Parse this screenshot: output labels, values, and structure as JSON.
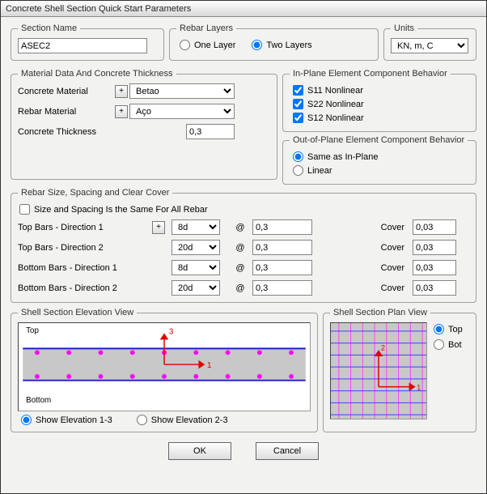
{
  "window_title": "Concrete Shell Section Quick Start Parameters",
  "section_name": {
    "legend": "Section Name",
    "value": "ASEC2"
  },
  "rebar_layers": {
    "legend": "Rebar Layers",
    "one": "One Layer",
    "two": "Two Layers",
    "selected": "two"
  },
  "units": {
    "legend": "Units",
    "value": "KN, m, C"
  },
  "material": {
    "legend": "Material Data And Concrete Thickness",
    "concrete_label": "Concrete Material",
    "concrete_value": "Betao",
    "rebar_label": "Rebar Material",
    "rebar_value": "Aço",
    "thickness_label": "Concrete Thickness",
    "thickness_value": "0,3",
    "plus": "+"
  },
  "inplane": {
    "legend": "In-Plane Element Component Behavior",
    "s11": "S11 Nonlinear",
    "s22": "S22 Nonlinear",
    "s12": "S12 Nonlinear"
  },
  "outplane": {
    "legend": "Out-of-Plane Element Component Behavior",
    "same": "Same as In-Plane",
    "linear": "Linear",
    "selected": "same"
  },
  "rebar_size": {
    "legend": "Rebar Size, Spacing and Clear Cover",
    "same_all": "Size and Spacing Is the Same For All Rebar",
    "rows": [
      {
        "label": "Top Bars  -  Direction 1",
        "size": "8d",
        "at": "@",
        "spacing": "0,3",
        "cover_label": "Cover",
        "cover": "0,03",
        "plus": true
      },
      {
        "label": "Top Bars  -  Direction 2",
        "size": "20d",
        "at": "@",
        "spacing": "0,3",
        "cover_label": "Cover",
        "cover": "0,03",
        "plus": false
      },
      {
        "label": "Bottom Bars  -  Direction 1",
        "size": "8d",
        "at": "@",
        "spacing": "0,3",
        "cover_label": "Cover",
        "cover": "0,03",
        "plus": false
      },
      {
        "label": "Bottom Bars  -  Direction 2",
        "size": "20d",
        "at": "@",
        "spacing": "0,3",
        "cover_label": "Cover",
        "cover": "0,03",
        "plus": false
      }
    ]
  },
  "elev": {
    "legend": "Shell Section Elevation View",
    "top": "Top",
    "bottom": "Bottom",
    "axis1": "1",
    "axis3": "3",
    "show13": "Show Elevation 1-3",
    "show23": "Show Elevation 2-3",
    "selected": "13"
  },
  "plan": {
    "legend": "Shell Section Plan View",
    "top": "Top",
    "bot": "Bot",
    "axis1": "1",
    "axis2": "2",
    "selected": "top"
  },
  "buttons": {
    "ok": "OK",
    "cancel": "Cancel"
  }
}
